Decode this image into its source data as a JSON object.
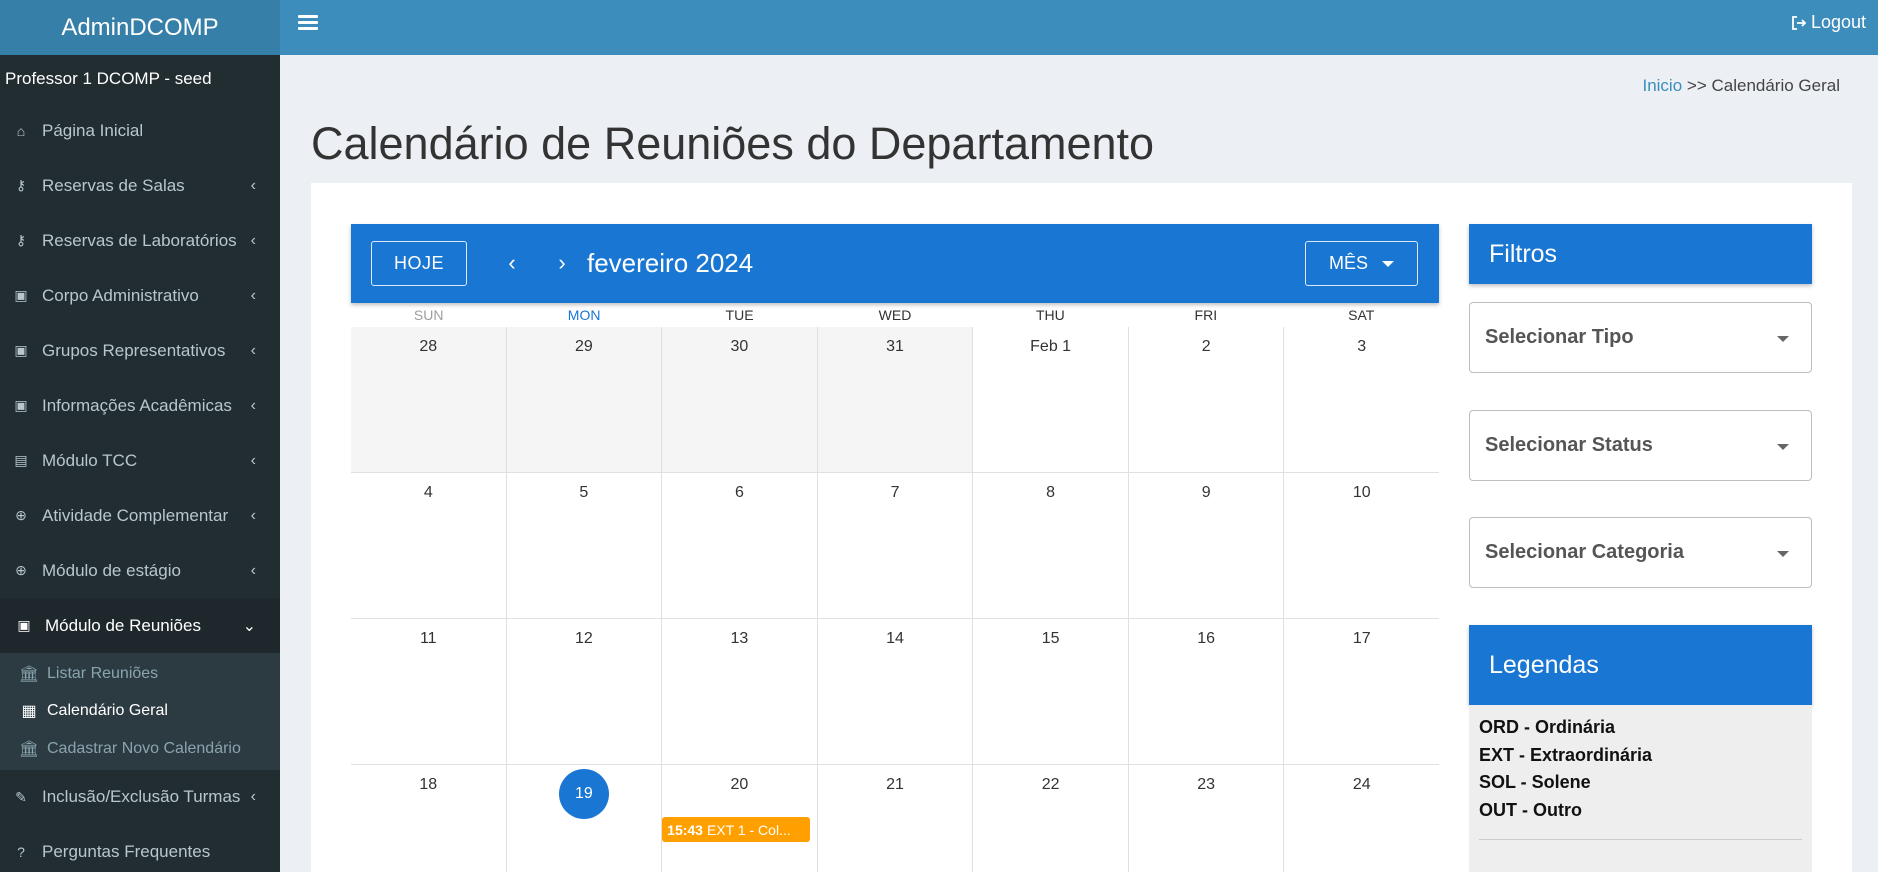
{
  "header": {
    "brand": "AdminDCOMP",
    "logout_label": "Logout"
  },
  "sidebar": {
    "user": "Professor 1 DCOMP - seed",
    "items": [
      {
        "label": "Página Inicial",
        "icon": "home-icon",
        "chevron": ""
      },
      {
        "label": "Reservas de Salas",
        "icon": "key-icon",
        "chevron": "‹"
      },
      {
        "label": "Reservas de Laboratórios",
        "icon": "key-icon",
        "chevron": "‹"
      },
      {
        "label": "Corpo Administrativo",
        "icon": "contact-card-icon",
        "chevron": "‹"
      },
      {
        "label": "Grupos Representativos",
        "icon": "contact-card-icon",
        "chevron": "‹"
      },
      {
        "label": "Informações Acadêmicas",
        "icon": "contact-card-icon",
        "chevron": "‹"
      },
      {
        "label": "Módulo TCC",
        "icon": "book-icon",
        "chevron": "‹"
      },
      {
        "label": "Atividade Complementar",
        "icon": "plus-circle-icon",
        "chevron": "‹"
      },
      {
        "label": "Módulo de estágio",
        "icon": "plus-circle-icon",
        "chevron": "‹"
      },
      {
        "label": "Módulo de Reuniões",
        "icon": "contact-card-icon",
        "chevron": "⌄"
      }
    ],
    "submenu": [
      {
        "label": "Listar Reuniões",
        "icon": "bank-icon"
      },
      {
        "label": "Calendário Geral",
        "icon": "calendar-icon"
      },
      {
        "label": "Cadastrar Novo Calendário",
        "icon": "bank-icon"
      }
    ],
    "bottom_items": [
      {
        "label": "Inclusão/Exclusão Turmas",
        "icon": "edit-icon",
        "chevron": "‹"
      },
      {
        "label": "Perguntas Frequentes",
        "icon": "question-icon",
        "chevron": ""
      }
    ]
  },
  "breadcrumb": {
    "home": "Inicio",
    "separator": ">>",
    "current": "Calendário Geral"
  },
  "page_title": "Calendário de Reuniões do Departamento",
  "calendar": {
    "today_button": "HOJE",
    "prev": "‹",
    "next": "›",
    "month_label": "fevereiro 2024",
    "view_button": "MÊS",
    "weekdays": [
      "SUN",
      "MON",
      "TUE",
      "WED",
      "THU",
      "FRI",
      "SAT"
    ],
    "weeks": [
      [
        "28",
        "29",
        "30",
        "31",
        "Feb 1",
        "2",
        "3"
      ],
      [
        "4",
        "5",
        "6",
        "7",
        "8",
        "9",
        "10"
      ],
      [
        "11",
        "12",
        "13",
        "14",
        "15",
        "16",
        "17"
      ],
      [
        "18",
        "19",
        "20",
        "21",
        "22",
        "23",
        "24"
      ]
    ],
    "today": "19",
    "event": {
      "time": "15:43",
      "title": "EXT 1 - Col...",
      "color": "#ffa000"
    },
    "accent_color": "#1976d2"
  },
  "filters": {
    "title": "Filtros",
    "tipo": "Selecionar Tipo",
    "status": "Selecionar Status",
    "categoria": "Selecionar Categoria"
  },
  "legend": {
    "title": "Legendas",
    "items": [
      "ORD - Ordinária",
      "EXT - Extraordinária",
      "SOL - Solene",
      "OUT - Outro"
    ]
  }
}
